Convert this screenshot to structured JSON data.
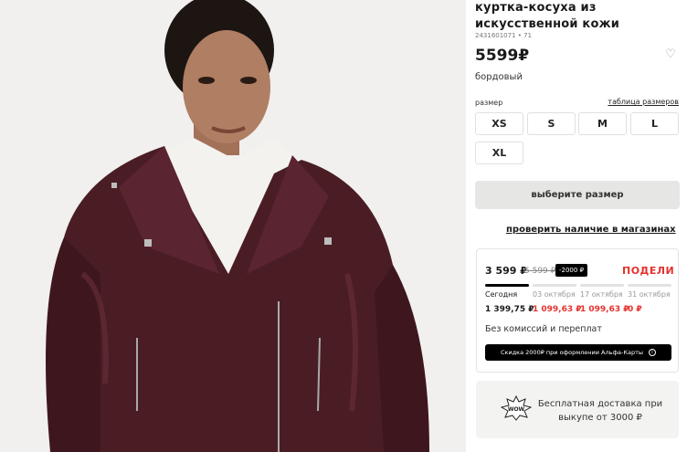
{
  "product": {
    "title": "куртка-косуха из искусственной кожи",
    "sku": "2431601071 • 71",
    "price": "5599₽",
    "color": "бордовый"
  },
  "sizes": {
    "label": "размер",
    "table_link": "таблица размеров",
    "options": [
      "XS",
      "S",
      "M",
      "L",
      "XL"
    ]
  },
  "actions": {
    "choose_size": "выберите размер",
    "check_stores": "проверить наличие в магазинах"
  },
  "split_payment": {
    "price": "3 599 ₽",
    "old_price": "5 599 ₽",
    "discount_badge": "-2000 ₽",
    "brand": "ПОДЕЛИ",
    "schedule": [
      {
        "date": "Сегодня",
        "amount": "1 399,75 ₽"
      },
      {
        "date": "03 октября",
        "amount": "1 099,63 ₽"
      },
      {
        "date": "17 октября",
        "amount": "1 099,63 ₽"
      },
      {
        "date": "31 октября",
        "amount": "0 ₽"
      }
    ],
    "no_fees": "Без комиссий и переплат",
    "promo": "Скидка 2000₽ при оформлении Альфа-Карты",
    "info_icon": "i"
  },
  "delivery": {
    "badge": "WOW",
    "text": "Бесплатная доставка при выкупе от 3000 ₽"
  },
  "colors": {
    "jacket": "#4a1d24",
    "accent_red": "#e5322d",
    "button_gray": "#e6e6e4"
  }
}
